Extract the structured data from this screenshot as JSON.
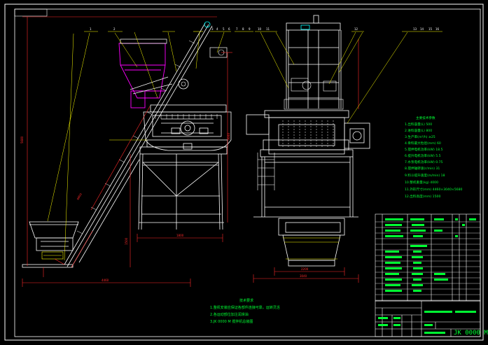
{
  "drawing": {
    "drawing_number": "JK 0000 M",
    "balloon_numbers_side": [
      "1",
      "2",
      "3",
      "4",
      "5",
      "6",
      "7",
      "8",
      "9",
      "10",
      "11",
      "12",
      "13"
    ],
    "balloon_numbers_front": [
      "1",
      "2",
      "3",
      "4",
      "5",
      "6",
      "7",
      "8",
      "9",
      "10",
      "11",
      "12",
      "13",
      "14",
      "15",
      "16"
    ]
  },
  "notes": {
    "heading": "技术要求",
    "lines": [
      "1.整机安装应保证各部件连接可靠，运转灵活",
      "2.各运动部位加注润滑油",
      "3.JK 0000 M 搅拌机总装图"
    ]
  },
  "specs": {
    "heading": "主要技术参数",
    "lines": [
      "1.出料容量(L)  500",
      "2.进料容量(L)  800",
      "3.生产率(m³/h)  ≥25",
      "4.骨料最大粒径(mm)  60",
      "5.搅拌电机功率(kW)  18.5",
      "6.提升电机功率(kW)  5.5",
      "7.水泵电机功率(kW)  0.75",
      "8.搅拌轴转速(r/min)  31",
      "9.料斗提升速度(m/min)  18",
      "10.整机重量(kg)  4000",
      "11.外形尺寸(mm)  4460×3040×5680",
      "12.出料高度(mm)  1500"
    ]
  },
  "colors": {
    "background": "#000000",
    "frame": "#ffffff",
    "machine": "#ffffff",
    "leader": "#ffff00",
    "dimension": "#ff2a2a",
    "hopper": "#ff00ff",
    "text": "#00ff33",
    "cyan": "#00ffff"
  }
}
